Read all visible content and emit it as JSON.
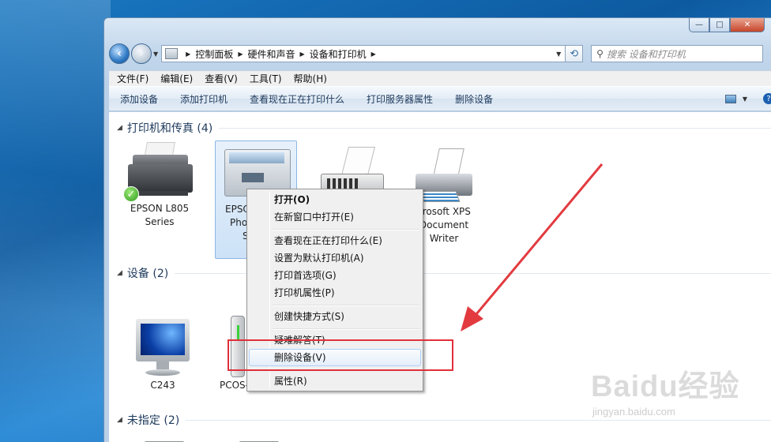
{
  "window": {
    "controls": [
      "—",
      "□",
      "✕"
    ]
  },
  "address": {
    "crumbs": [
      "控制面板",
      "硬件和声音",
      "设备和打印机"
    ],
    "search_placeholder": "搜索 设备和打印机"
  },
  "menu": [
    "文件(F)",
    "编辑(E)",
    "查看(V)",
    "工具(T)",
    "帮助(H)"
  ],
  "toolbar": [
    "添加设备",
    "添加打印机",
    "查看现在正在打印什么",
    "打印服务器属性",
    "删除设备"
  ],
  "groups": {
    "printers": {
      "title": "打印机和传真 (4)",
      "items": [
        {
          "line1": "EPSON L805",
          "line2": "Series",
          "line3": ""
        },
        {
          "line1": "EPSO",
          "line2": "Pho",
          "line3": "S"
        },
        {
          "line1": "",
          "line2": "",
          "line3": ""
        },
        {
          "line1": "crosoft XPS",
          "line2": "Document",
          "line3": "Writer"
        }
      ]
    },
    "devices": {
      "title": "设备 (2)",
      "items": [
        {
          "line1": "C243"
        },
        {
          "line1": "PCOS-"
        }
      ]
    },
    "unspecified": {
      "title": "未指定 (2)"
    }
  },
  "context_menu": {
    "items": [
      "打开(O)",
      "在新窗口中打开(E)",
      "查看现在正在打印什么(E)",
      "设置为默认打印机(A)",
      "打印首选项(G)",
      "打印机属性(P)",
      "创建快捷方式(S)",
      "疑难解答(T)",
      "删除设备(V)",
      "属性(R)"
    ]
  },
  "watermark": {
    "logo": "Baidu经验",
    "url": "jingyan.baidu.com"
  },
  "colors": {
    "highlight_box": "#e0303a",
    "arrow": "#e23a3f"
  },
  "icons": {
    "back": "arrow-left-icon",
    "forward": "arrow-right-icon",
    "refresh": "refresh-icon",
    "search": "search-icon",
    "help": "help-icon",
    "default_printer": "checkmark-icon"
  }
}
